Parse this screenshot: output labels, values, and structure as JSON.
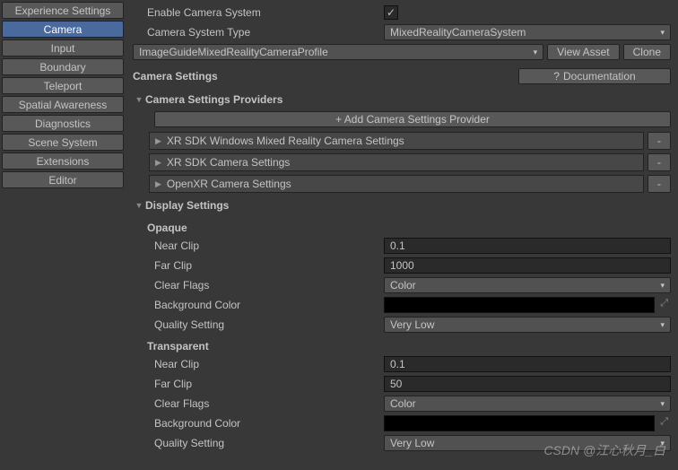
{
  "sidebar": {
    "items": [
      {
        "label": "Experience Settings"
      },
      {
        "label": "Camera"
      },
      {
        "label": "Input"
      },
      {
        "label": "Boundary"
      },
      {
        "label": "Teleport"
      },
      {
        "label": "Spatial Awareness"
      },
      {
        "label": "Diagnostics"
      },
      {
        "label": "Scene System"
      },
      {
        "label": "Extensions"
      },
      {
        "label": "Editor"
      }
    ],
    "active_index": 1
  },
  "top": {
    "enable_label": "Enable Camera System",
    "enable_checked": "✓",
    "system_type_label": "Camera System Type",
    "system_type_value": "MixedRealityCameraSystem",
    "profile_value": "ImageGuideMixedRealityCameraProfile",
    "view_asset": "View Asset",
    "clone": "Clone"
  },
  "camera_settings": {
    "title": "Camera Settings",
    "doc_label": "Documentation"
  },
  "providers": {
    "title": "Camera Settings Providers",
    "add_label": "+ Add Camera Settings Provider",
    "items": [
      {
        "label": "XR SDK Windows Mixed Reality Camera Settings"
      },
      {
        "label": "XR SDK Camera Settings"
      },
      {
        "label": "OpenXR Camera Settings"
      }
    ],
    "remove": "-"
  },
  "display": {
    "title": "Display Settings",
    "opaque": {
      "title": "Opaque",
      "near_clip_label": "Near Clip",
      "near_clip": "0.1",
      "far_clip_label": "Far Clip",
      "far_clip": "1000",
      "clear_flags_label": "Clear Flags",
      "clear_flags": "Color",
      "bg_label": "Background Color",
      "quality_label": "Quality Setting",
      "quality": "Very Low"
    },
    "transparent": {
      "title": "Transparent",
      "near_clip_label": "Near Clip",
      "near_clip": "0.1",
      "far_clip_label": "Far Clip",
      "far_clip": "50",
      "clear_flags_label": "Clear Flags",
      "clear_flags": "Color",
      "bg_label": "Background Color",
      "quality_label": "Quality Setting",
      "quality": "Very Low"
    }
  },
  "watermark": "CSDN @江心秋月_白"
}
